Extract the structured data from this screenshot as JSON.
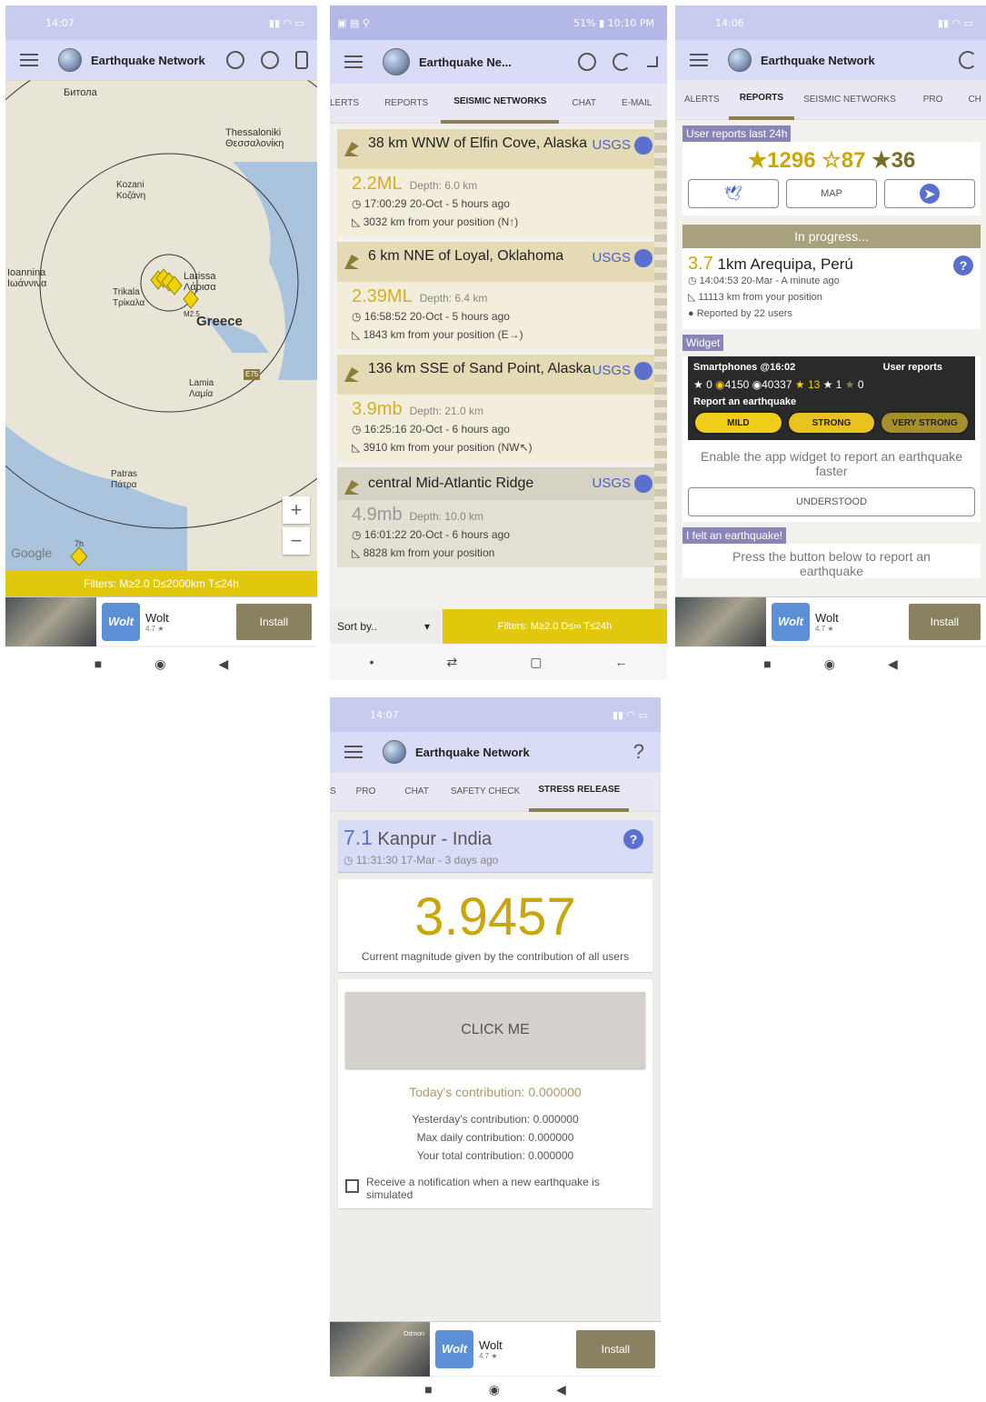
{
  "app": {
    "title": "Earthquake Network"
  },
  "screen1": {
    "status_time": "14:07",
    "map_labels": [
      {
        "text": "Битола"
      },
      {
        "text": "Thessaloniki\nΘεσσαλονίκη"
      },
      {
        "text": "Kozani\nΚοζάνη"
      },
      {
        "text": "Ioannina\nΙωάννινα"
      },
      {
        "text": "Trikala\nΤρίκαλα"
      },
      {
        "text": "Larissa\nΛάρισα"
      },
      {
        "text": "Greece"
      },
      {
        "text": "Lamia\nΛαμία"
      },
      {
        "text": "Patras\nΠάτρα"
      },
      {
        "text": "M2.5"
      },
      {
        "text": "7h"
      },
      {
        "text": "E75"
      }
    ],
    "google": "Google",
    "zoom_in": "+",
    "zoom_out": "−",
    "filters": "Filters: M≥2.0 D≤2000km T≤24h",
    "ad": {
      "name": "Wolt",
      "rating": "4.7 ★",
      "logo": "Wolt",
      "install": "Install"
    }
  },
  "screen2": {
    "status_time": "51% ▮ 10:10 PM",
    "title": "Earthquake Ne...",
    "tabs": [
      "LERTS",
      "REPORTS",
      "SEISMIC NETWORKS",
      "CHAT",
      "E-MAIL"
    ],
    "active_tab": 2,
    "quakes": [
      {
        "place": "38 km WNW of Elfin Cove, Alaska",
        "source": "USGS",
        "mag": "2.2ML",
        "depth": "Depth: 6.0 km",
        "time": "17:00:29 20-Oct - 5 hours ago",
        "dist": "3032 km from your position (N↑)"
      },
      {
        "place": "6 km NNE of Loyal, Oklahoma",
        "source": "USGS",
        "mag": "2.39ML",
        "depth": "Depth: 6.4 km",
        "time": "16:58:52 20-Oct - 5 hours ago",
        "dist": "1843 km from your position (E→)"
      },
      {
        "place": "136 km SSE of Sand Point, Alaska",
        "source": "USGS",
        "mag": "3.9mb",
        "depth": "Depth: 21.0 km",
        "time": "16:25:16 20-Oct - 6 hours ago",
        "dist": "3910 km from your position (NW↖)"
      },
      {
        "place": "central Mid-Atlantic Ridge",
        "source": "USGS",
        "mag": "4.9mb",
        "depth": "Depth: 10.0 km",
        "time": "16:01:22 20-Oct - 6 hours ago",
        "dist": "8828 km from your position"
      }
    ],
    "sort_by": "Sort by..",
    "filters": "Filters: M≥2.0 D≤∞ T≤24h"
  },
  "screen3": {
    "status_time": "14:06",
    "tabs": [
      "ALERTS",
      "REPORTS",
      "SEISMIC NETWORKS",
      "PRO",
      "CH"
    ],
    "active_tab": 1,
    "reports_header": "User reports last 24h",
    "counts": [
      "★1296",
      "☆87",
      "★36"
    ],
    "buttons": {
      "twitter": "twitter-icon",
      "map": "MAP",
      "telegram": "telegram-icon"
    },
    "in_progress": "In progress...",
    "report": {
      "mag": "3.7",
      "place": "1km Arequipa, Perú",
      "time": "14:04:53 20-Mar - A minute ago",
      "dist": "11113 km from your position",
      "reported": "Reported by 22 users"
    },
    "widget_header": "Widget",
    "widget": {
      "smartphones": "Smartphones @16:02",
      "user_reports": "User reports",
      "a": "0",
      "b": "4150",
      "c": "40337",
      "d": "13",
      "e": "1",
      "f": "0",
      "report": "Report an earthquake",
      "mild": "MILD",
      "strong": "STRONG",
      "very_strong": "VERY STRONG"
    },
    "widget_text": "Enable the app widget to report an earthquake faster",
    "understood": "UNDERSTOOD",
    "felt_header": "I felt an earthquake!",
    "felt_text": "Press the button below to report an earthquake"
  },
  "screen4": {
    "status_time": "14:07",
    "help": "?",
    "tabs": [
      "S",
      "PRO",
      "CHAT",
      "SAFETY CHECK",
      "STRESS RELEASE"
    ],
    "active_tab": 4,
    "event": {
      "mag": "7.1",
      "place": "Kanpur - India",
      "time": "11:31:30 17-Mar - 3 days ago"
    },
    "big_value": "3.9457",
    "big_caption": "Current magnitude given by the contribution of all users",
    "click_me": "CLICK ME",
    "today": "Today's contribution: 0.000000",
    "yesterday": "Yesterday's contribution: 0.000000",
    "max_daily": "Max daily contribution: 0.000000",
    "total": "Your total contribution: 0.000000",
    "notify": "Receive a notification when a new earthquake is simulated",
    "ad_caption": "Odmori"
  }
}
